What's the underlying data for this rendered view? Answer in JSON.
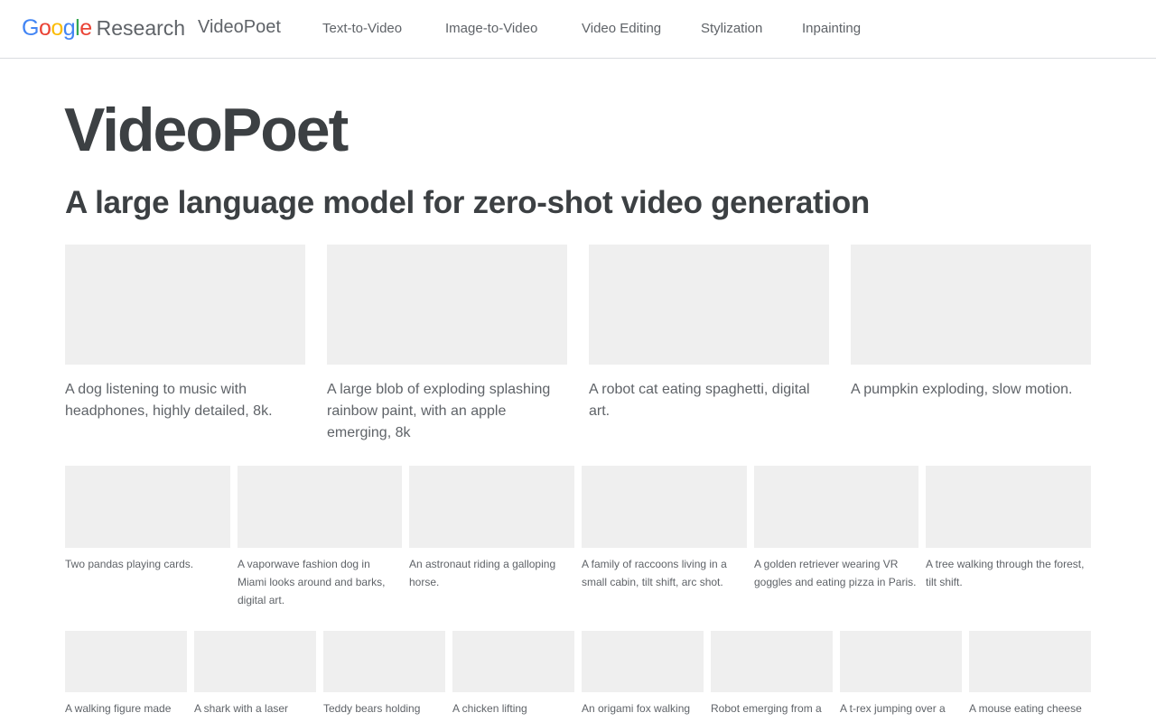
{
  "header": {
    "brand_letters": [
      "G",
      "o",
      "o",
      "g",
      "l",
      "e"
    ],
    "brand_colors": [
      "#4285F4",
      "#EA4335",
      "#FBBC05",
      "#4285F4",
      "#34A853",
      "#EA4335"
    ],
    "brand_suffix": "Research",
    "product": "VideoPoet",
    "nav": [
      "Text-to-Video",
      "Image-to-Video",
      "Video Editing",
      "Stylization",
      "Inpainting"
    ]
  },
  "hero": {
    "title": "VideoPoet",
    "subtitle": "A large language model for zero-shot video generation"
  },
  "row1": [
    "A dog listening to music with headphones, highly detailed, 8k.",
    "A large blob of exploding splashing rainbow paint, with an apple emerging, 8k",
    "A robot cat eating spaghetti, digital art.",
    "A pumpkin exploding, slow motion."
  ],
  "row2": [
    "Two pandas playing cards.",
    "A vaporwave fashion dog in Miami looks around and barks, digital art.",
    "An astronaut riding a galloping horse.",
    "A family of raccoons living in a small cabin, tilt shift, arc shot.",
    "A golden retriever wearing VR goggles and eating pizza in Paris.",
    "A tree walking through the forest, tilt shift."
  ],
  "row3": [
    "A walking figure made",
    "A shark with a laser",
    "Teddy bears holding",
    "A chicken lifting",
    "An origami fox walking",
    "Robot emerging from a",
    "A t-rex jumping over a",
    "A mouse eating cheese"
  ],
  "colors": {
    "thumb_placeholder": "#efefef",
    "text_dark": "#3c4043",
    "text_muted": "#5f6368",
    "divider": "#dadce0"
  }
}
